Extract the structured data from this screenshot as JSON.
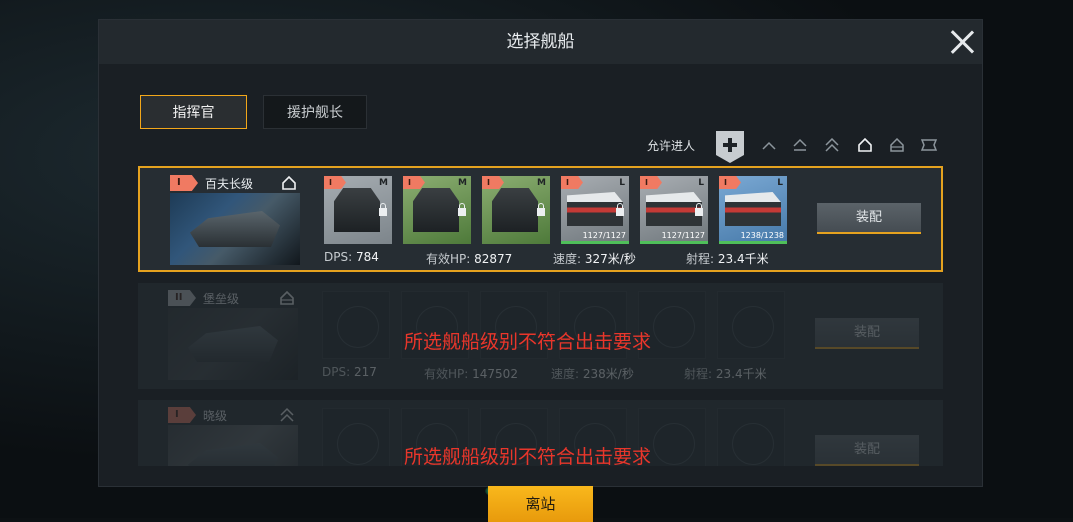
{
  "window": {
    "title": "选择舰船"
  },
  "tabs": [
    {
      "label": "指挥官",
      "active": true
    },
    {
      "label": "援护舰长",
      "active": false
    }
  ],
  "filter": {
    "allow_label": "允许进人"
  },
  "ships": [
    {
      "rank": "I",
      "class_name": "百夫长级",
      "selected": true,
      "slots": [
        {
          "type": "M",
          "color": "grey",
          "locked": true
        },
        {
          "type": "M",
          "color": "green",
          "locked": true
        },
        {
          "type": "M",
          "color": "green",
          "locked": true
        },
        {
          "type": "L",
          "color": "red",
          "locked": true,
          "ammo": "1127/1127"
        },
        {
          "type": "L",
          "color": "red",
          "locked": true,
          "ammo": "1127/1127"
        },
        {
          "type": "L",
          "color": "blue",
          "locked": false,
          "ammo": "1238/1238"
        }
      ],
      "stats": {
        "dps_label": "DPS:",
        "dps": "784",
        "hp_label": "有效HP:",
        "hp": "82877",
        "speed_label": "速度:",
        "speed": "327米/秒",
        "range_label": "射程:",
        "range": "23.4千米"
      },
      "equip_label": "装配",
      "warning": ""
    },
    {
      "rank": "II",
      "class_name": "堡垒级",
      "selected": false,
      "stats": {
        "dps_label": "DPS:",
        "dps": "217",
        "hp_label": "有效HP:",
        "hp": "147502",
        "speed_label": "速度:",
        "speed": "238米/秒",
        "range_label": "射程:",
        "range": "23.4千米"
      },
      "equip_label": "装配",
      "warning": "所选舰船级别不符合出击要求"
    },
    {
      "rank": "I",
      "class_name": "晓级",
      "selected": false,
      "equip_label": "装配",
      "warning": "所选舰船级别不符合出击要求"
    }
  ],
  "footer": {
    "leave_label": "离站"
  },
  "colors": {
    "accent": "#e5a21f",
    "warning": "#e9362b",
    "button_primary": "#f5ac17"
  }
}
